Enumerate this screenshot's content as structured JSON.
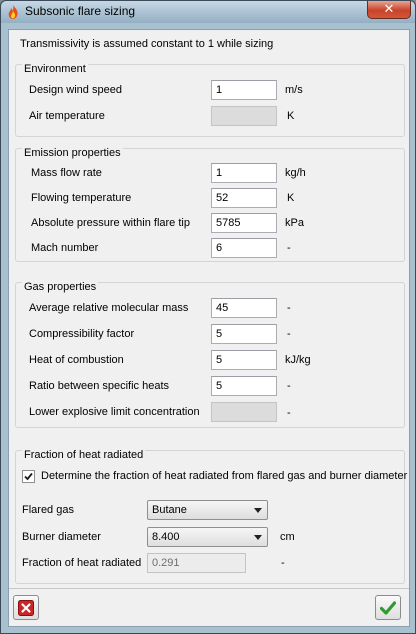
{
  "window": {
    "title": "Subsonic flare sizing",
    "close_glyph": "✕"
  },
  "note": "Transmissivity is assumed constant to 1 while sizing",
  "environment": {
    "title": "Environment",
    "wind_speed": {
      "label": "Design wind speed",
      "value": "1",
      "unit": "m/s"
    },
    "air_temp": {
      "label": "Air temperature",
      "value": "",
      "unit": "K"
    }
  },
  "emission": {
    "title": "Emission properties",
    "mass_flow": {
      "label": "Mass flow rate",
      "value": "1",
      "unit": "kg/h"
    },
    "flowing_temp": {
      "label": "Flowing temperature",
      "value": "52",
      "unit": "K"
    },
    "abs_pressure": {
      "label": "Absolute pressure within flare tip",
      "value": "5785",
      "unit": "kPa"
    },
    "mach": {
      "label": "Mach number",
      "value": "6",
      "unit": "-"
    }
  },
  "gas": {
    "title": "Gas properties",
    "molecular_mass": {
      "label": "Average relative molecular mass",
      "value": "45",
      "unit": "-"
    },
    "compressibility": {
      "label": "Compressibility factor",
      "value": "5",
      "unit": "-"
    },
    "heat_combustion": {
      "label": "Heat of combustion",
      "value": "5",
      "unit": "kJ/kg"
    },
    "specific_heats": {
      "label": "Ratio between specific heats",
      "value": "5",
      "unit": "-"
    },
    "lel": {
      "label": "Lower explosive limit concentration",
      "value": "",
      "unit": "-"
    }
  },
  "radiated": {
    "title": "Fraction of heat radiated",
    "checkbox_label": "Determine the fraction of heat radiated from flared gas and burner diameter",
    "checked": true,
    "flared_gas": {
      "label": "Flared gas",
      "selected": "Butane"
    },
    "burner": {
      "label": "Burner diameter",
      "selected": "8.400",
      "unit": "cm"
    },
    "fraction": {
      "label": "Fraction of heat radiated",
      "value": "0.291",
      "unit": "-"
    }
  },
  "colors": {
    "cancel": "#c62828",
    "ok": "#2e9b2e"
  },
  "icons": {
    "app": "flame-icon",
    "cancel": "x-icon",
    "ok": "checkmark-icon"
  }
}
